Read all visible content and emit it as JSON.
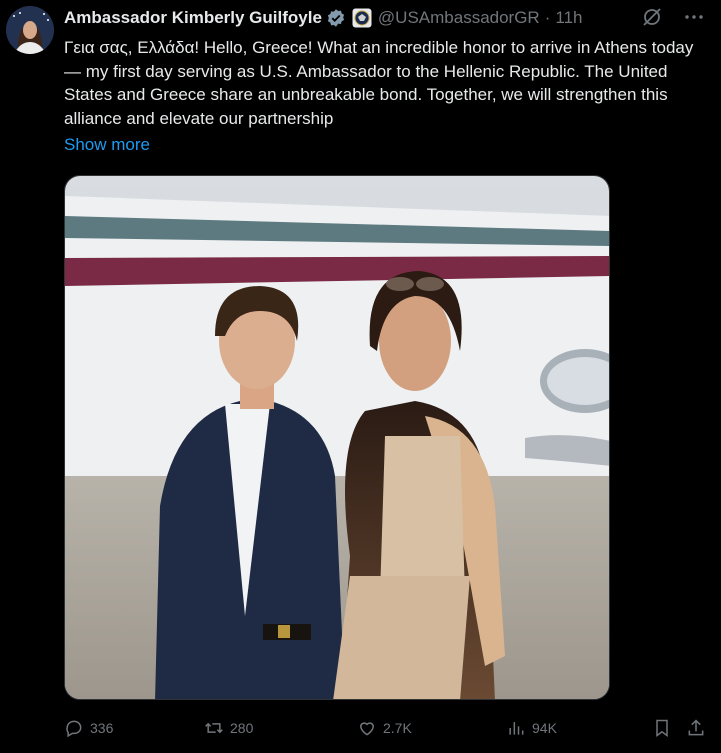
{
  "author": {
    "name": "Ambassador Kimberly Guilfoyle",
    "handle": "@USAmbassadorGR",
    "separator": "·",
    "time": "11h"
  },
  "tweet": {
    "text": "Γεια σας, Ελλάδα! Hello, Greece! What an incredible honor to arrive in Athens today — my first day serving as U.S. Ambassador to the Hellenic Republic. The United States and Greece share an unbreakable bond. Together, we will strengthen this alliance and elevate our partnership",
    "show_more": "Show more"
  },
  "icons": {
    "verified": "verified-badge-icon",
    "affiliation": "government-seal-icon",
    "grok": "grok-icon",
    "more": "more-icon",
    "reply": "reply-icon",
    "repost": "repost-icon",
    "like": "heart-icon",
    "views": "views-icon",
    "bookmark": "bookmark-icon",
    "share": "share-icon"
  },
  "metrics": {
    "replies": "336",
    "reposts": "280",
    "likes": "2.7K",
    "views": "94K"
  },
  "colors": {
    "background": "#000000",
    "text": "#e7e9ea",
    "secondary": "#71767b",
    "link": "#1d9bf0"
  }
}
